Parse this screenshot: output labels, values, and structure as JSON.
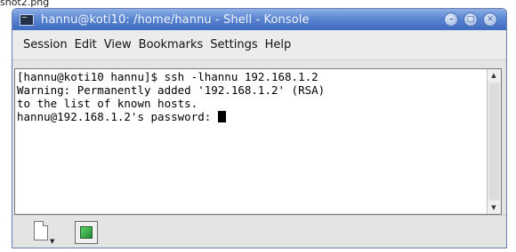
{
  "caption": "shot2.png",
  "window": {
    "title": "hannu@koti10: /home/hannu - Shell - Konsole",
    "buttons": {
      "minimize": "–",
      "maximize": "□",
      "close": "✕"
    }
  },
  "menubar": {
    "items": [
      "Session",
      "Edit",
      "View",
      "Bookmarks",
      "Settings",
      "Help"
    ]
  },
  "terminal": {
    "lines": [
      "[hannu@koti10 hannu]$ ssh -lhannu 192.168.1.2",
      "Warning: Permanently added '192.168.1.2' (RSA)",
      "to the list of known hosts.",
      "hannu@192.168.1.2's password: "
    ]
  },
  "scrollbar": {
    "up_arrow": "▲",
    "down_arrow": "▼"
  },
  "tabbar": {
    "dropdown_arrow": "▼",
    "icons": [
      "new-document-icon",
      "console-session-icon"
    ]
  }
}
